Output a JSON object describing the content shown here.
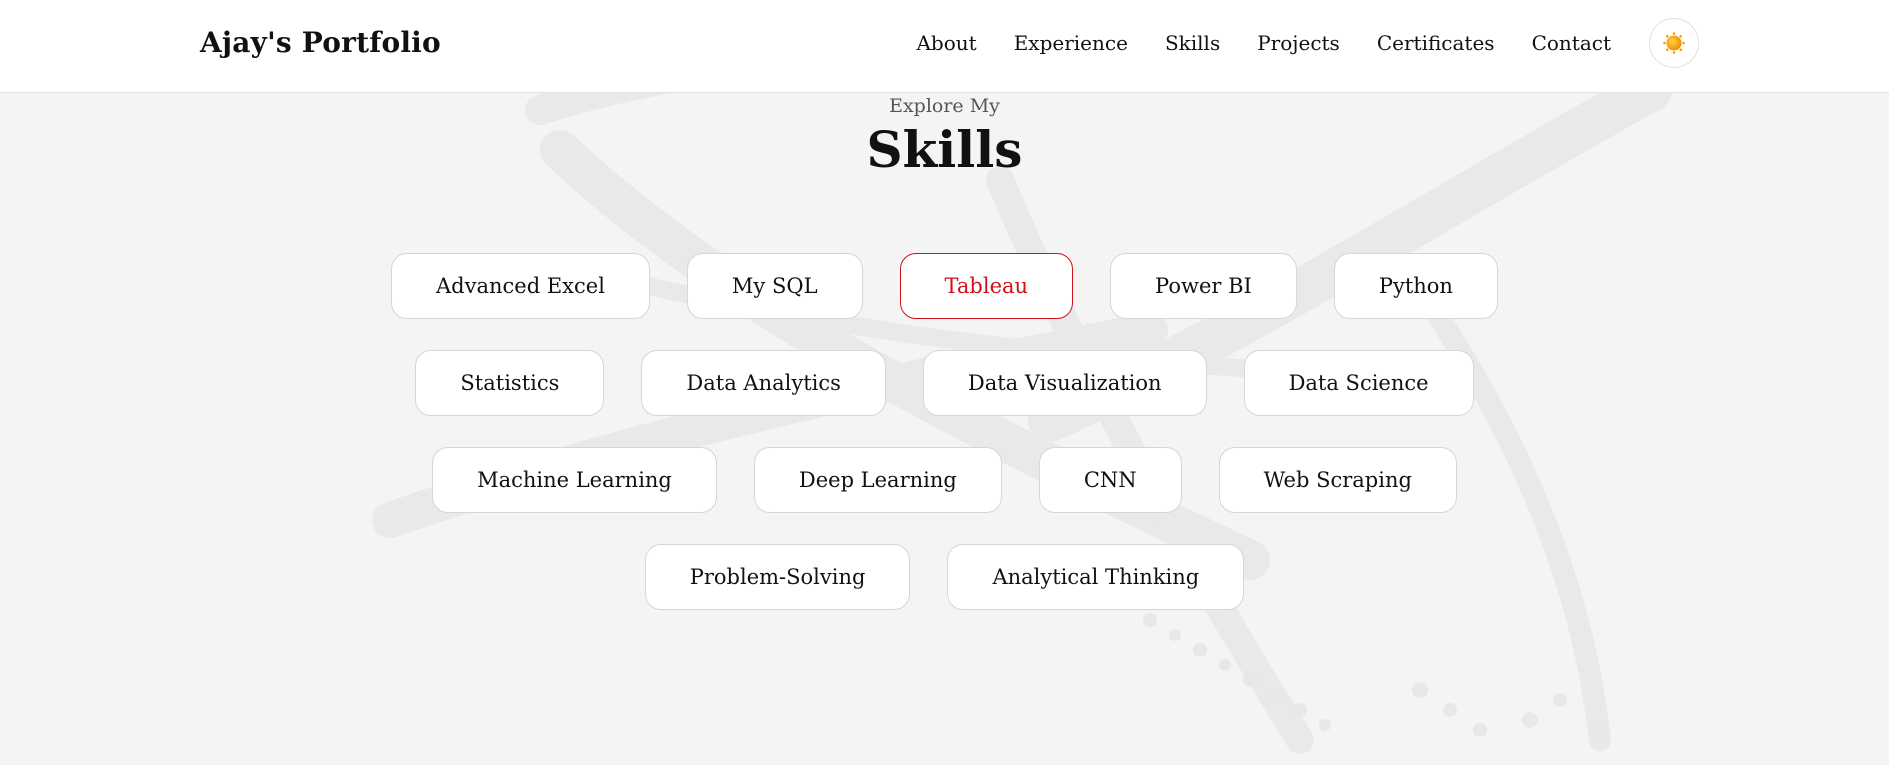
{
  "header": {
    "brand": "Ajay's Portfolio",
    "nav": [
      "About",
      "Experience",
      "Skills",
      "Projects",
      "Certificates",
      "Contact"
    ],
    "theme_icon": "sun-icon"
  },
  "section": {
    "eyebrow": "Explore My",
    "title": "Skills"
  },
  "skills": {
    "rows": [
      [
        "Advanced Excel",
        "My SQL",
        "Tableau",
        "Power BI",
        "Python"
      ],
      [
        "Statistics",
        "Data Analytics",
        "Data Visualization",
        "Data Science"
      ],
      [
        "Machine Learning",
        "Deep Learning",
        "CNN",
        "Web Scraping"
      ],
      [
        "Problem-Solving",
        "Analytical Thinking"
      ]
    ],
    "active": "Tableau"
  },
  "colors": {
    "accent": "#d0101a",
    "background": "#f4f4f4",
    "header_bg": "#ffffff",
    "sun": "#f5a300"
  }
}
